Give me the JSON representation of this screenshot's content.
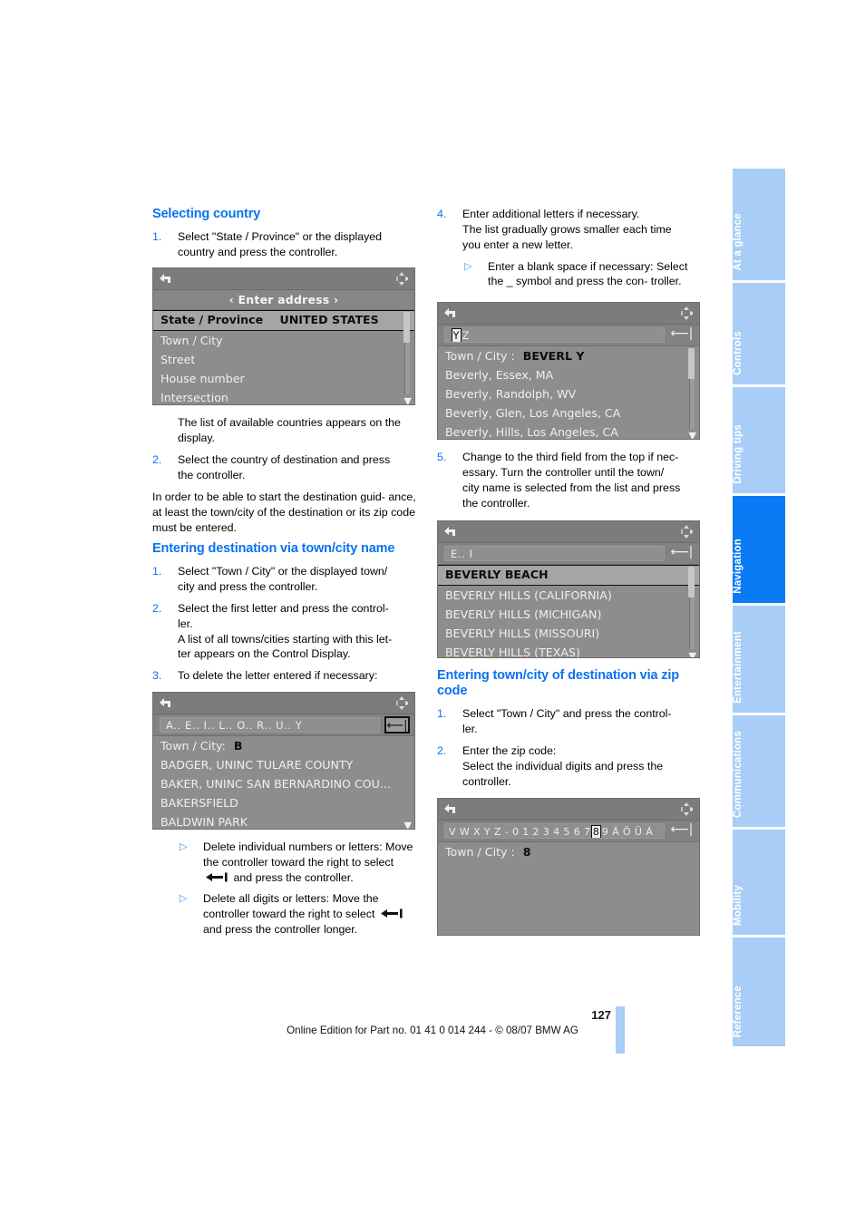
{
  "document": {
    "page_number": "127",
    "footer_note": "Online Edition for Part no. 01 41 0 014 244 - © 08/07 BMW AG"
  },
  "colors": {
    "heading_blue": "#0a72f0",
    "tab_inactive": "#a8cdf7",
    "tab_active": "#0a7af5",
    "screen_bg": "#8d8d8d"
  },
  "rail": {
    "tabs": [
      {
        "label": "At a glance",
        "active": false
      },
      {
        "label": "Controls",
        "active": false
      },
      {
        "label": "Driving tips",
        "active": false
      },
      {
        "label": "Navigation",
        "active": true
      },
      {
        "label": "Entertainment",
        "active": false
      },
      {
        "label": "Communications",
        "active": false
      },
      {
        "label": "Mobility",
        "active": false
      },
      {
        "label": "Reference",
        "active": false
      }
    ]
  },
  "left_column": {
    "heading_selecting_country": "Selecting country",
    "step1_num": "1.",
    "step1_line1": "Select \"State / Province\" or the displayed",
    "step1_line2": "country and press the controller.",
    "screen1": {
      "title": "‹ Enter address ›",
      "back_icon": "back-arrow-icon",
      "compass_icon": "compass-icon",
      "rows": [
        {
          "label": "State / Province",
          "value": "UNITED STATES",
          "selected": true
        },
        {
          "label": "Town / City",
          "value": "",
          "selected": false
        },
        {
          "label": "Street",
          "value": "",
          "selected": false
        },
        {
          "label": "House number",
          "value": "",
          "selected": false
        },
        {
          "label": "Intersection",
          "value": "",
          "selected": false
        }
      ]
    },
    "after_screen1_line1": "The list of available countries appears on",
    "after_screen1_line2": "the display.",
    "step2_num": "2.",
    "step2_line1": "Select the country of destination and press",
    "step2_line2": "the controller.",
    "para_line1": "In order to be able to start the destination guid-",
    "para_line2": "ance, at least the town/city of the destination or",
    "para_line3": "its zip code must be entered.",
    "heading_entering_town": "Entering destination via town/city name",
    "t1_num": "1.",
    "t1_line1": "Select \"Town / City\" or the displayed town/",
    "t1_line2": "city and press the controller.",
    "t2_num": "2.",
    "t2_line1": "Select the first letter and press the control-",
    "t2_line2": "ler.",
    "t2_line3": "A list of all towns/cities starting with this let-",
    "t2_line4": "ter appears on the Control Display.",
    "t3_num": "3.",
    "t3_line1": "To delete the letter entered if necessary:",
    "screen2": {
      "keyboard": "A.. E.. I.. L.. O.. R.. U.. Y",
      "enter_icon": "enter-key-icon",
      "query_label": "Town / City:",
      "query_value": "B",
      "rows": [
        "BADGER, UNINC TULARE COUNTY",
        "BAKER, UNINC SAN BERNARDINO COU...",
        "BAKERSFIELD",
        "BALDWIN PARK"
      ]
    },
    "b1_line1": "Delete individual numbers or letters:",
    "b1_line2": "Move the controller toward the right to",
    "b1_line3a": "select",
    "b1_line3b": "and press the controller.",
    "b2_line1": "Delete all digits or letters:",
    "b2_line2": "Move the controller toward the right to",
    "b2_line3a": "select",
    "b2_line3b": "and press the controller",
    "b2_line4": "longer."
  },
  "right_column": {
    "step4_num": "4.",
    "step4_line1": "Enter additional letters if necessary.",
    "step4_line2": "The list gradually grows smaller each time",
    "step4_line3": "you enter a new letter.",
    "sub4_line1": "Enter a blank space if necessary:",
    "sub4_line2": "Select the _ symbol and press the con-",
    "sub4_line3": "troller.",
    "screen3": {
      "keyboard_selected": "Y",
      "keyboard_rest": "Z",
      "enter_icon": "enter-key-icon",
      "query_label": "Town / City :",
      "query_value": "BEVERL Y",
      "rows": [
        "Beverly, Essex, MA",
        "Beverly, Randolph, WV",
        "Beverly, Glen, Los Angeles, CA",
        "Beverly, Hills, Los Angeles, CA"
      ]
    },
    "step5_num": "5.",
    "step5_line1": "Change to the third field from the top if nec-",
    "step5_line2": "essary. Turn the controller until the town/",
    "step5_line3": "city name is selected from the list and press",
    "step5_line4": "the controller.",
    "screen4": {
      "keyboard": "E.. I",
      "enter_icon": "enter-key-icon",
      "rows": [
        {
          "text": "BEVERLY BEACH",
          "selected": true
        },
        {
          "text": "BEVERLY HILLS (CALIFORNIA)",
          "selected": false
        },
        {
          "text": "BEVERLY HILLS (MICHIGAN)",
          "selected": false
        },
        {
          "text": "BEVERLY HILLS (MISSOURI)",
          "selected": false
        },
        {
          "text": "BEVERLY HILLS (TEXAS)",
          "selected": false
        }
      ]
    },
    "heading_zip": "Entering town/city of destination via zip code",
    "z1_num": "1.",
    "z1_line1": "Select \"Town / City\" and press the control-",
    "z1_line2": "ler.",
    "z2_num": "2.",
    "z2_line1": "Enter the zip code:",
    "z2_line2": "Select the individual digits and press the",
    "z2_line3": "controller.",
    "screen5": {
      "keyboard_prefix": "V W X Y Z  - 0 1 2 3 4 5 6 7",
      "keyboard_selected": "8",
      "keyboard_suffix": "9 Ä Ö Ü Á",
      "enter_icon": "enter-key-icon",
      "query_label": "Town / City :",
      "query_value": "8"
    }
  }
}
